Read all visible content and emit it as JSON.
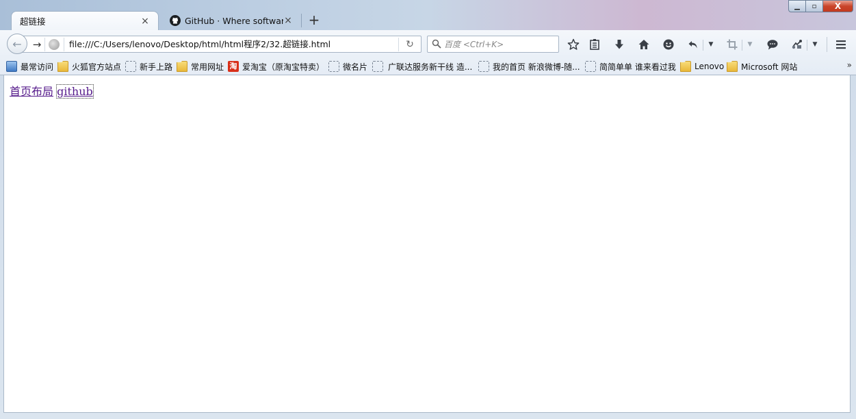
{
  "window": {
    "minimize_glyph": "▁",
    "maximize_glyph": "▫",
    "close_glyph": "X"
  },
  "tabs": [
    {
      "title": "超链接",
      "active": true,
      "close_glyph": "×"
    },
    {
      "title": "GitHub · Where software...",
      "active": false,
      "close_glyph": "×",
      "icon": "github-icon"
    }
  ],
  "new_tab_glyph": "+",
  "navbar": {
    "url": "file:///C:/Users/lenovo/Desktop/html/html程序2/32.超链接.html",
    "search_placeholder": "百度 <Ctrl+K>",
    "back_glyph": "←",
    "forward_glyph": "→",
    "reload_glyph": "↻"
  },
  "bookmarks": [
    {
      "label": "最常访问",
      "icon": "smart-folder-icon"
    },
    {
      "label": "火狐官方站点",
      "icon": "folder-icon"
    },
    {
      "label": "新手上路",
      "icon": "page-icon"
    },
    {
      "label": "常用网址",
      "icon": "folder-icon"
    },
    {
      "label": "爱淘宝（原淘宝特卖）",
      "icon": "taobao-icon",
      "icon_text": "淘"
    },
    {
      "label": "微名片",
      "icon": "page-icon"
    },
    {
      "label": "广联达服务新干线 造...",
      "icon": "page-icon"
    },
    {
      "label": "我的首页 新浪微博-随...",
      "icon": "page-icon"
    },
    {
      "label": "简简单单 谁来看过我",
      "icon": "page-icon"
    },
    {
      "label": "Lenovo",
      "icon": "folder-icon"
    },
    {
      "label": "Microsoft 网站",
      "icon": "folder-icon"
    }
  ],
  "bookmarks_overflow": "»",
  "page": {
    "links": [
      "首页布局",
      "github"
    ]
  },
  "colors": {
    "visited_link": "#551a8b",
    "close_button": "#c9452b"
  }
}
